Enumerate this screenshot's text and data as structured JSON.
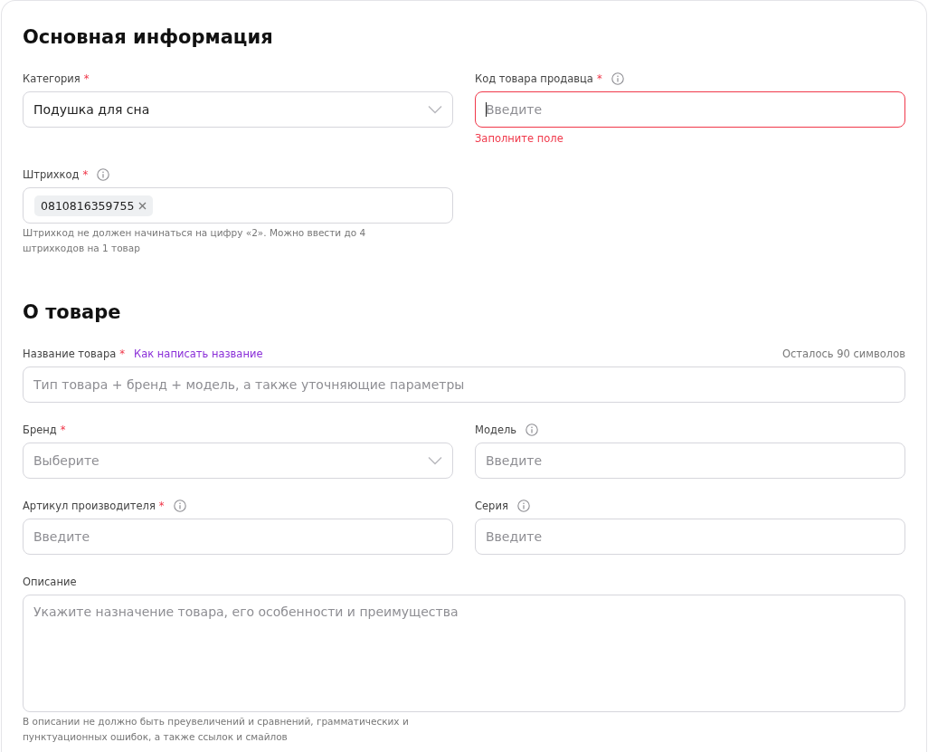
{
  "sections": [
    {
      "title": "Основная информация",
      "fields": [
        {
          "kind": "select",
          "label": "Категория",
          "required_mark": "*",
          "info": false,
          "value": "Подушка для сна"
        },
        {
          "kind": "input",
          "label": "Код товара продавца",
          "required_mark": "*",
          "info": true,
          "placeholder": "Введите",
          "invalid": true,
          "focused": true,
          "error": "Заполните поле"
        },
        {
          "kind": "tags",
          "label": "Штрихкод",
          "required_mark": "*",
          "info": true,
          "tags": [
            "0810816359755"
          ],
          "hint": "Штрихкод не должен начинаться на цифру «2». Можно ввести до 4 штрихкодов на 1 товар"
        }
      ]
    },
    {
      "title": "О товаре",
      "fields": [
        {
          "kind": "input",
          "label": "Название товара",
          "required_mark": "*",
          "info": false,
          "link": "Как написать название",
          "counter": "Осталось 90 символов",
          "placeholder": "Тип товара + бренд + модель, а также уточняющие параметры"
        },
        {
          "kind": "select",
          "label": "Бренд",
          "required_mark": "*",
          "info": false,
          "placeholder": "Выберите"
        },
        {
          "kind": "input",
          "label": "Модель",
          "info": true,
          "placeholder": "Введите"
        },
        {
          "kind": "input",
          "label": "Артикул производителя",
          "required_mark": "*",
          "info": true,
          "placeholder": "Введите"
        },
        {
          "kind": "input",
          "label": "Серия",
          "info": true,
          "placeholder": "Введите"
        },
        {
          "kind": "textarea",
          "label": "Описание",
          "info": false,
          "placeholder": "Укажите назначение товара, его особенности и преимущества",
          "hint": "В описании не должно быть преувеличений и сравнений, грамматических и пунктуационных ошибок, а также ссылок и смайлов"
        }
      ]
    }
  ]
}
